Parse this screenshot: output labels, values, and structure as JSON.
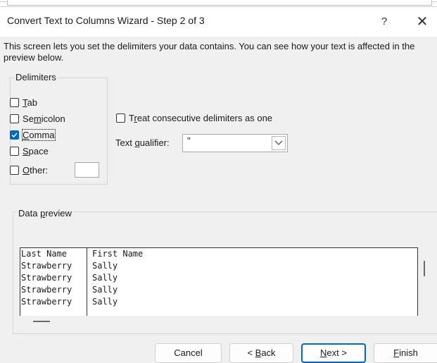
{
  "window": {
    "title": "Convert Text to Columns Wizard - Step 2 of 3",
    "help_label": "?",
    "close_label": "✕"
  },
  "instructions": "This screen lets you set the delimiters your data contains.  You can see how your text is affected in the preview below.",
  "delimiters": {
    "group_label": "Delimiters",
    "items": [
      {
        "pre": "",
        "key": "T",
        "post": "ab",
        "checked": false
      },
      {
        "pre": "Se",
        "key": "m",
        "post": "icolon",
        "checked": false
      },
      {
        "pre": "",
        "key": "C",
        "post": "omma",
        "checked": true
      },
      {
        "pre": "",
        "key": "S",
        "post": "pace",
        "checked": false
      },
      {
        "pre": "",
        "key": "O",
        "post": "ther:",
        "checked": false
      }
    ],
    "other_value": ""
  },
  "options": {
    "consecutive": {
      "pre": "T",
      "key": "r",
      "post": "eat consecutive delimiters as one",
      "checked": false
    },
    "qualifier": {
      "pre": "Text ",
      "key": "q",
      "post": "ualifier:",
      "value": "\""
    }
  },
  "preview": {
    "label_pre": "Data ",
    "label_key": "p",
    "label_post": "review",
    "columns": [
      [
        "Last Name",
        "Strawberry",
        "Strawberry",
        "Strawberry",
        "Strawberry"
      ],
      [
        "First Name",
        "Sally",
        "Sally",
        "Sally",
        "Sally"
      ]
    ]
  },
  "buttons": {
    "cancel": "Cancel",
    "back": {
      "pre": "< ",
      "key": "B",
      "post": "ack"
    },
    "next": {
      "pre": "",
      "key": "N",
      "post": "ext >"
    },
    "finish": {
      "pre": "",
      "key": "F",
      "post": "inish"
    }
  },
  "colors": {
    "accent": "#0067c0"
  }
}
